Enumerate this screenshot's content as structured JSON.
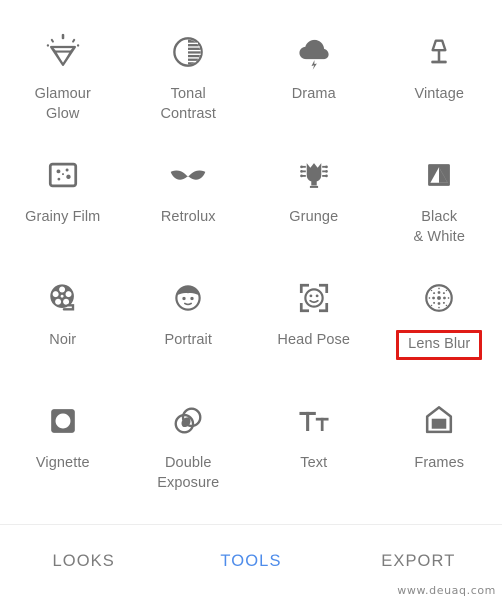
{
  "app": {
    "background_color": "#ffffff",
    "icon_color": "#6e6e6e",
    "label_color": "#757575",
    "accent_color": "#4e8cea",
    "highlight_color": "#e01b16"
  },
  "tools": [
    {
      "label": "Glamour\nGlow",
      "icon": "diamond-sparkle-icon",
      "highlighted": false
    },
    {
      "label": "Tonal\nContrast",
      "icon": "half-circle-contrast-icon",
      "highlighted": false
    },
    {
      "label": "Drama",
      "icon": "storm-cloud-icon",
      "highlighted": false
    },
    {
      "label": "Vintage",
      "icon": "table-lamp-icon",
      "highlighted": false
    },
    {
      "label": "Grainy Film",
      "icon": "grain-square-icon",
      "highlighted": false
    },
    {
      "label": "Retrolux",
      "icon": "moustache-icon",
      "highlighted": false
    },
    {
      "label": "Grunge",
      "icon": "guitar-headstock-icon",
      "highlighted": false
    },
    {
      "label": "Black\n& White",
      "icon": "black-white-square-icon",
      "highlighted": false
    },
    {
      "label": "Noir",
      "icon": "film-reel-icon",
      "highlighted": false
    },
    {
      "label": "Portrait",
      "icon": "face-portrait-icon",
      "highlighted": false
    },
    {
      "label": "Head Pose",
      "icon": "face-frame-icon",
      "highlighted": false
    },
    {
      "label": "Lens Blur",
      "icon": "lens-blur-dots-icon",
      "highlighted": true
    },
    {
      "label": "Vignette",
      "icon": "vignette-square-icon",
      "highlighted": false
    },
    {
      "label": "Double\nExposure",
      "icon": "double-exposure-circles-icon",
      "highlighted": false
    },
    {
      "label": "Text",
      "icon": "text-tt-icon",
      "highlighted": false
    },
    {
      "label": "Frames",
      "icon": "picture-frame-icon",
      "highlighted": false
    }
  ],
  "bottom_nav": {
    "tabs": [
      {
        "label": "LOOKS",
        "active": false
      },
      {
        "label": "TOOLS",
        "active": true
      },
      {
        "label": "EXPORT",
        "active": false
      }
    ]
  },
  "watermark": {
    "text": "www.deuaq.com"
  }
}
